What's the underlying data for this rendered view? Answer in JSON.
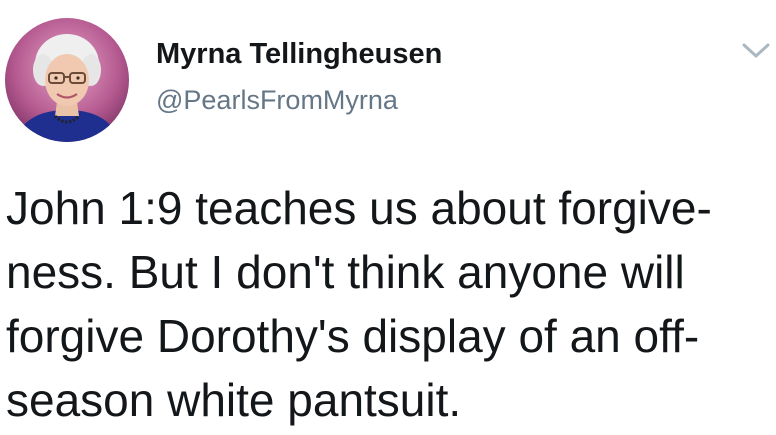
{
  "author": {
    "name": "Myrna Tellingheusen",
    "handle": "@PearlsFromMyrna",
    "avatar_icon": "profile-photo"
  },
  "menu": {
    "icon": "chevron-down-icon",
    "color": "#aab8c2"
  },
  "tweet": {
    "lines": [
      "John 1:9 teaches us about forgive-",
      "ness. But I don't think anyone will",
      "forgive Dorothy's display of an off-",
      "season white pantsuit."
    ]
  },
  "colors": {
    "text": "#14171a",
    "handle": "#657786",
    "background": "#ffffff"
  }
}
